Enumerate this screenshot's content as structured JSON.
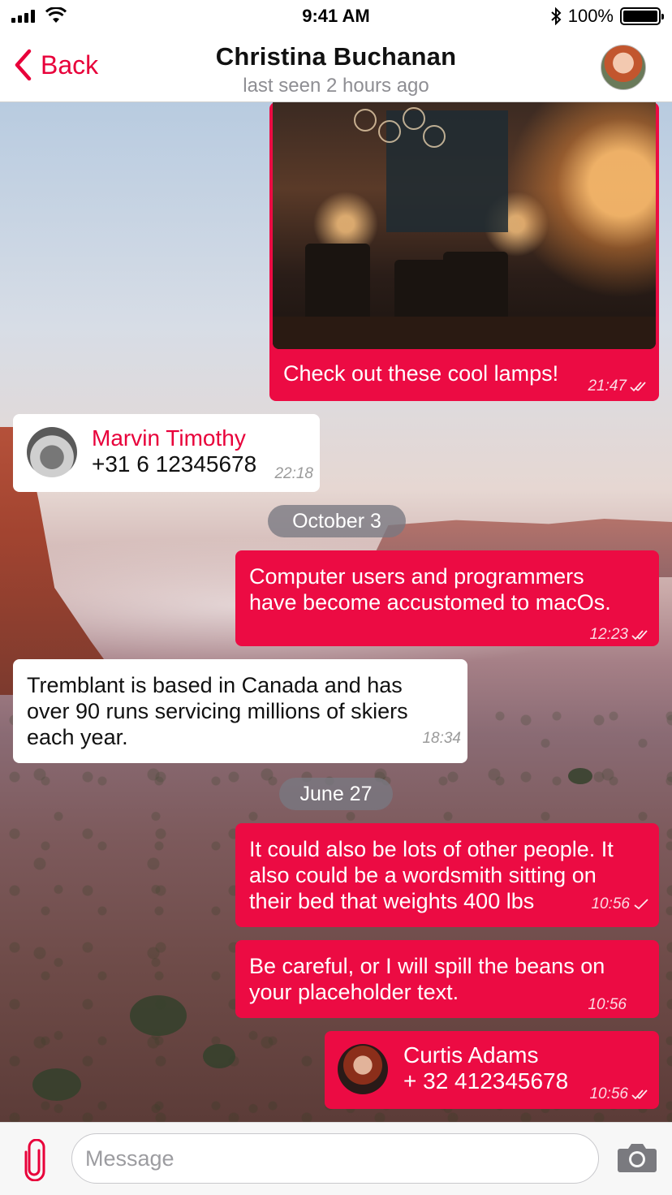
{
  "status_bar": {
    "time": "9:41 AM",
    "battery_percent": "100%",
    "battery_level": 1.0
  },
  "header": {
    "back_label": "Back",
    "contact_name": "Christina Buchanan",
    "last_seen": "last seen 2 hours ago"
  },
  "messages": [
    {
      "type": "photo",
      "direction": "out",
      "caption": "Check out these cool lamps!",
      "time": "21:47",
      "status": "read"
    },
    {
      "type": "contact",
      "direction": "in",
      "name": "Marvin Timothy",
      "phone": "+31 6 12345678",
      "time": "22:18"
    },
    {
      "type": "date",
      "label": "October 3"
    },
    {
      "type": "text",
      "direction": "out",
      "lines": [
        "Computer users and programmers",
        "have become accustomed to macOs."
      ],
      "time": "12:23",
      "status": "read"
    },
    {
      "type": "text",
      "direction": "in",
      "lines": [
        "Tremblant is based in Canada and has",
        "over 90 runs servicing millions of skiers",
        "each year."
      ],
      "time": "18:34"
    },
    {
      "type": "date",
      "label": "June 27"
    },
    {
      "type": "text",
      "direction": "out",
      "lines": [
        "It could also be lots of other people. It",
        "also could be a wordsmith sitting on",
        "their bed that weights 400 lbs"
      ],
      "time": "10:56",
      "status": "sent"
    },
    {
      "type": "text",
      "direction": "out",
      "lines": [
        "Be careful, or I will spill the beans on",
        "your placeholder text."
      ],
      "time": "10:56",
      "status": "none"
    },
    {
      "type": "contact",
      "direction": "out",
      "name": "Curtis Adams",
      "phone": "+ 32 412345678",
      "time": "10:56",
      "status": "read"
    }
  ],
  "input": {
    "placeholder": "Message"
  },
  "colors": {
    "accent": "#ec0b43",
    "incoming_bubble": "#ffffff",
    "date_pill": "#787882"
  },
  "icons": [
    "signal-icon",
    "wifi-icon",
    "bluetooth-icon",
    "battery-icon",
    "back-chevron-icon",
    "double-check-icon",
    "single-check-icon",
    "paperclip-icon",
    "camera-icon"
  ]
}
